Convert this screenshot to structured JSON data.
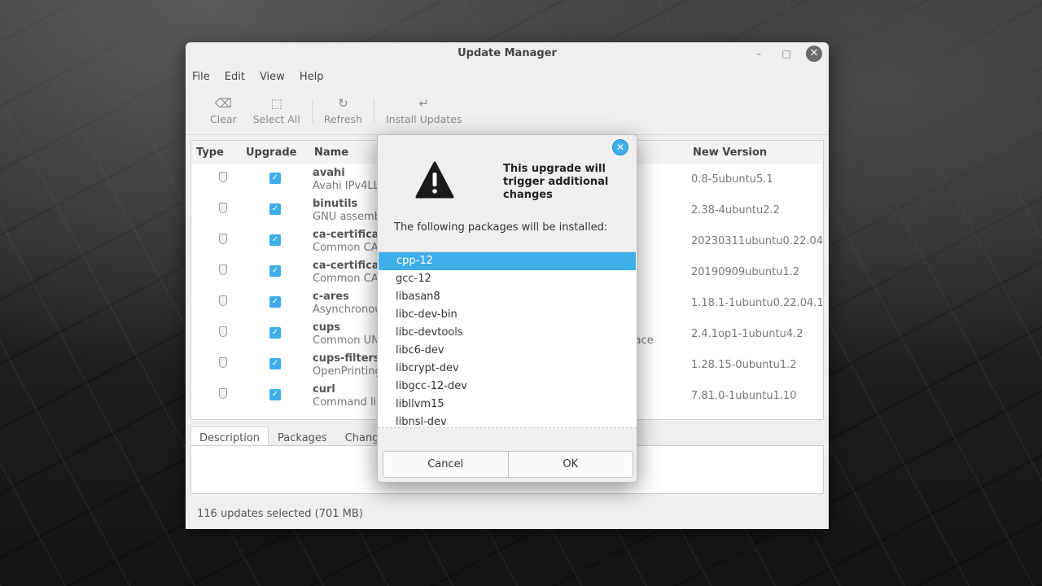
{
  "window": {
    "title": "Update Manager",
    "controls": {
      "minimize": "–",
      "maximize": "□",
      "close": "✕"
    }
  },
  "menubar": {
    "items": [
      "File",
      "Edit",
      "View",
      "Help"
    ]
  },
  "toolbar": {
    "buttons": [
      {
        "label": "Clear",
        "icon": "clear-icon",
        "glyph": "⌫"
      },
      {
        "label": "Select All",
        "icon": "select-all-icon",
        "glyph": "⬚"
      },
      {
        "label": "Refresh",
        "icon": "refresh-icon",
        "glyph": "↻"
      },
      {
        "label": "Install Updates",
        "icon": "install-icon",
        "glyph": "↵"
      }
    ]
  },
  "list": {
    "headers": {
      "type": "Type",
      "upgrade": "Upgrade",
      "name": "Name",
      "new_version": "New Version"
    },
    "rows": [
      {
        "name": "avahi",
        "desc": "Avahi IPv4LL",
        "version": "0.8-5ubuntu5.1",
        "checked": true
      },
      {
        "name": "binutils",
        "desc": "GNU assembl",
        "version": "2.38-4ubuntu2.2",
        "checked": true
      },
      {
        "name": "ca-certificate",
        "desc": "Common CA",
        "version": "20230311ubuntu0.22.04.1",
        "checked": true
      },
      {
        "name": "ca-certificate",
        "desc": "Common CA",
        "version": "20190909ubuntu1.2",
        "checked": true
      },
      {
        "name": "c-ares",
        "desc": "Asynchronou",
        "version": "1.18.1-1ubuntu0.22.04.1",
        "checked": true
      },
      {
        "name": "cups",
        "desc": "Common UNI",
        "version": "2.4.1op1-1ubuntu4.2",
        "checked": true,
        "extra": "face"
      },
      {
        "name": "cups-filters",
        "desc": "OpenPrinting",
        "version": "1.28.15-0ubuntu1.2",
        "checked": true
      },
      {
        "name": "curl",
        "desc": "Command lin",
        "version": "7.81.0-1ubuntu1.10",
        "checked": true
      }
    ]
  },
  "tabs": [
    "Description",
    "Packages",
    "Changel"
  ],
  "status": {
    "text": "116 updates selected (701 MB)"
  },
  "dialog": {
    "title": "This upgrade will trigger additional changes",
    "message": "The following packages will be installed:",
    "packages": [
      "cpp-12",
      "gcc-12",
      "libasan8",
      "libc-dev-bin",
      "libc-devtools",
      "libc6-dev",
      "libcrypt-dev",
      "libgcc-12-dev",
      "libllvm15",
      "libnsl-dev"
    ],
    "selected_index": 0,
    "cancel_label": "Cancel",
    "ok_label": "OK",
    "close_glyph": "✕"
  },
  "colors": {
    "accent": "#3daee9",
    "window_bg": "#efefef"
  }
}
